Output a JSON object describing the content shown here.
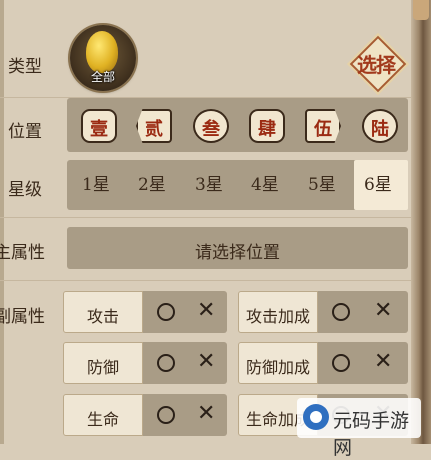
{
  "labels": {
    "type": "类型",
    "position": "位置",
    "star": "星级",
    "main_attr": "主属性",
    "sub_attr": "副属性"
  },
  "type_filter": {
    "label": "全部",
    "icon": "gold-gem-icon"
  },
  "select_button": "选择",
  "positions": [
    "壹",
    "贰",
    "叁",
    "肆",
    "伍",
    "陆"
  ],
  "stars": [
    "1星",
    "2星",
    "3星",
    "4星",
    "5星",
    "6星"
  ],
  "selected_star": "6星",
  "main_attr_placeholder": "请选择位置",
  "sub_attrs": {
    "left": [
      "攻击",
      "防御",
      "生命"
    ],
    "right": [
      "攻击加成",
      "防御加成",
      "生命加成"
    ]
  },
  "watermark": "元码手游网",
  "colors": {
    "panel": "#a99c86",
    "accent_red": "#9b2a12",
    "background": "#d9cdb9"
  }
}
